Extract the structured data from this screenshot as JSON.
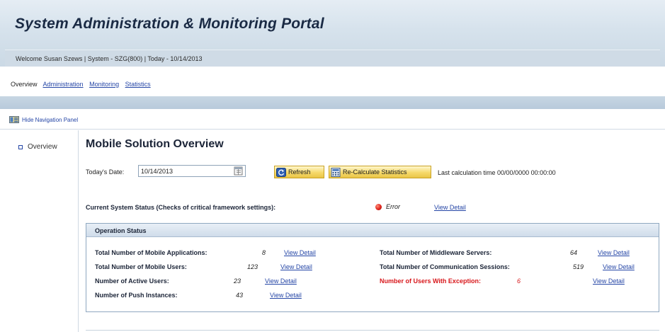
{
  "header": {
    "title": "System Administration & Monitoring Portal",
    "welcome": "Welcome Susan Szews | System - SZG(800) | Today - 10/14/2013"
  },
  "topnav": {
    "items": [
      "Overview",
      "Administration",
      "Monitoring",
      "Statistics"
    ]
  },
  "nav_toggle": {
    "label": "Hide Navigation Panel",
    "icon": "navigation-panel-icon"
  },
  "leftnav": {
    "items": [
      {
        "label": "Overview"
      }
    ]
  },
  "main": {
    "title": "Mobile Solution Overview",
    "date_label": "Today's Date:",
    "date_value": "10/14/2013",
    "refresh_label": "Refresh",
    "recalc_label": "Re-Calculate Statistics",
    "last_calc": "Last calculation time 00/00/0000 00:00:00",
    "status_label": "Current System Status (Checks of critical framework settings):",
    "status_text": "Error",
    "status_link": "View Detail"
  },
  "operation": {
    "title": "Operation Status",
    "left": [
      {
        "label": "Total Number of Mobile Applications:",
        "value": "8",
        "link": "View Detail"
      },
      {
        "label": "Total Number of Mobile Users:",
        "value": "123",
        "link": "View Detail"
      },
      {
        "label": "Number of Active Users:",
        "value": "23",
        "link": "View Detail"
      },
      {
        "label": "Number of Push Instances:",
        "value": "43",
        "link": "View Detail"
      }
    ],
    "right": [
      {
        "label": "Total Number of Middleware Servers:",
        "value": "64",
        "link": "View Detail"
      },
      {
        "label": "Total Number of Communication Sessions:",
        "value": "519",
        "link": "View Detail"
      },
      {
        "label": "Number of Users With Exception:",
        "value": "6",
        "link": "View Detail"
      }
    ]
  },
  "colors": {
    "accent_link": "#2546a6",
    "error": "#d8171b",
    "button_fill": "#f6d96a",
    "header_bg": "#d6e2ec"
  }
}
